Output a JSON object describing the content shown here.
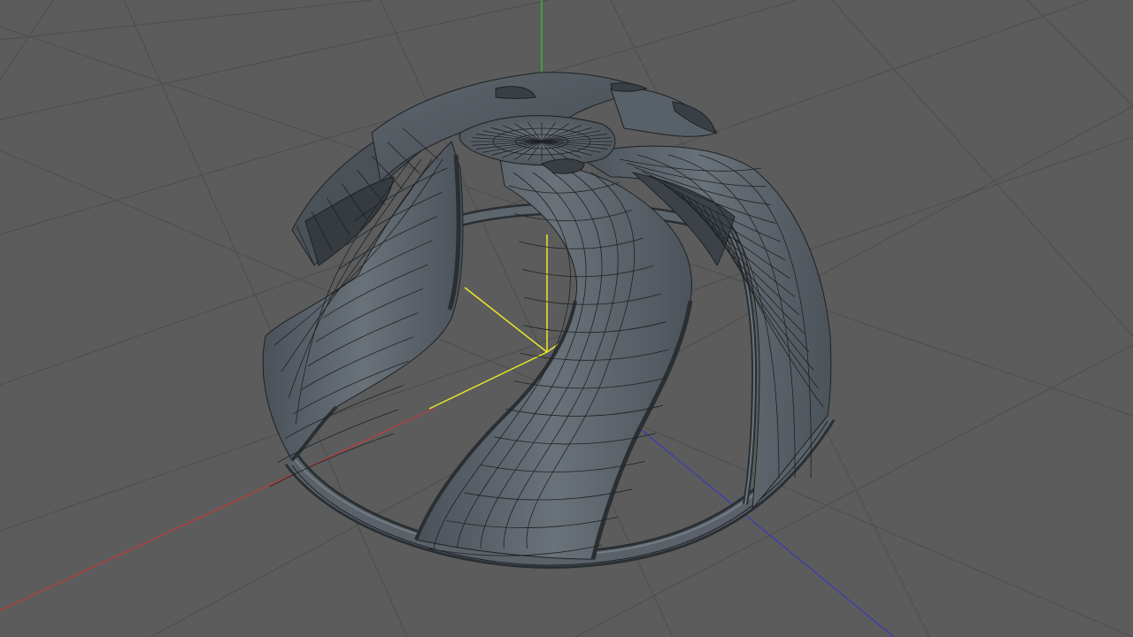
{
  "viewport": {
    "label": "",
    "colors": {
      "background": "#5c5c5c",
      "grid_line": "#4d4d4d",
      "axis_x": "#c23a3a",
      "axis_y": "#2fbd2f",
      "axis_z": "#3a3ab8",
      "object_axis": "#e8e62a",
      "mesh_fill": "#586068",
      "mesh_dark": "#3a3f45",
      "mesh_light": "#70787f",
      "wireframe": "#1e2226"
    },
    "object": {
      "type": "hemispherical-ribbed-bowl",
      "rib_count": 6
    }
  }
}
